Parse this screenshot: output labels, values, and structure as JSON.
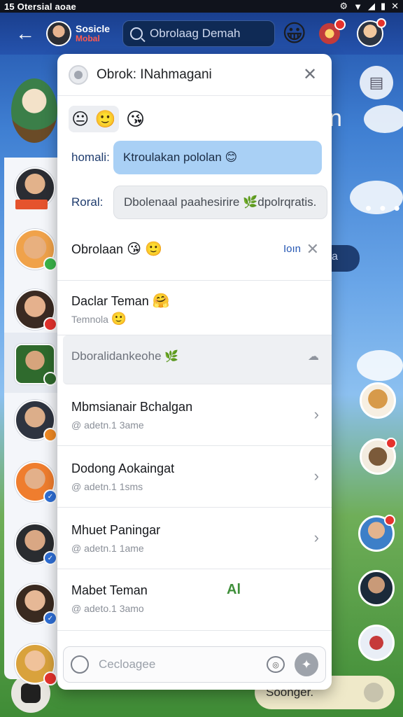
{
  "status_bar": {
    "left_text": "15 Otersial aoae",
    "icons": [
      "gear-icon",
      "wifi-icon",
      "signal-icon",
      "battery-icon",
      "close-icon"
    ]
  },
  "top_bar": {
    "user_name": "Sosicle",
    "user_status": "Mobal",
    "search_text": "Obrolaag Demah",
    "emoji": "😀"
  },
  "background": {
    "letter": "n",
    "more_dots": "• • •",
    "pill_text": "a",
    "bottom_pill_text": "Soonger."
  },
  "card": {
    "title": "Obrok: INahmagani",
    "emoji_bar": [
      "😐",
      "🙂",
      "😘"
    ],
    "fields": [
      {
        "label": "homali:",
        "value": "Ktroulakan pololan 😊",
        "icon": "😊"
      },
      {
        "label": "Roral:",
        "value": "Dbolenaal paahesirire 🌿dpolrqratis."
      }
    ],
    "items": [
      {
        "title": "Obrolaan",
        "emoji": [
          "😘",
          "🙂"
        ],
        "action": "Ioın",
        "subtitle": ""
      },
      {
        "title": "Daclar Teman",
        "emoji": [
          "🤗"
        ],
        "subtitle": "Temnola",
        "sub_emoji": "🙂"
      },
      {
        "title": "Dboralidankeohe",
        "emoji": [
          "🌿"
        ],
        "subtitle": ""
      },
      {
        "title": "Mbmsianair Bchalgan",
        "subtitle": "@ adetn.1 3ame"
      },
      {
        "title": "Dodong Aokaingat",
        "subtitle": "@ adetn.1 1sms"
      },
      {
        "title": "Mhuet Paningar",
        "subtitle": "@ adetn.1 1ame"
      },
      {
        "title": "Mabet Teman",
        "subtitle": "@ adeto.1 3amo",
        "tag": "Al"
      }
    ],
    "input_placeholder": "Cecloagee"
  },
  "colors": {
    "accent_blue": "#a9d0f5",
    "topbar": "#2553ad",
    "badge_red": "#e5322d"
  }
}
